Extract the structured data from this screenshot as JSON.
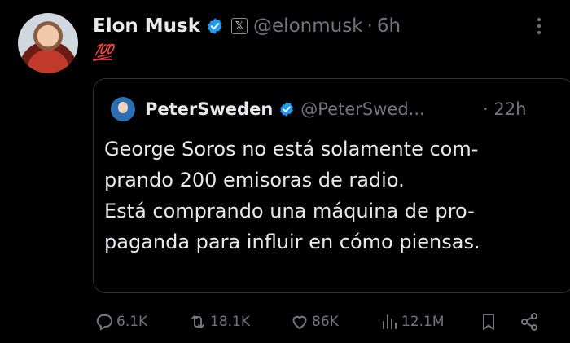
{
  "author": {
    "name": "Elon Musk",
    "handle": "@elonmusk",
    "separator": "·",
    "time": "6h",
    "badge_letter": "𝕏",
    "verified_color": "#1d9bf0",
    "icon": "x-affiliate-badge-icon"
  },
  "tweet": {
    "text": "💯"
  },
  "quoted": {
    "name": "PeterSweden",
    "handle": "@PeterSwed...",
    "separator": "·",
    "time": "22h",
    "lines": [
      "George Soros no está solamente com-",
      "prando 200 emisoras de radio.",
      "Está comprando una máquina de pro-",
      "paganda para influir en cómo piensas."
    ]
  },
  "actions": {
    "replies": "6.1K",
    "reposts": "18.1K",
    "likes": "86K",
    "views": "12.1M"
  },
  "colors": {
    "background": "#000000",
    "text": "#e7e9ea",
    "muted": "#71767b",
    "accent": "#1d9bf0",
    "border": "#2f3336"
  }
}
